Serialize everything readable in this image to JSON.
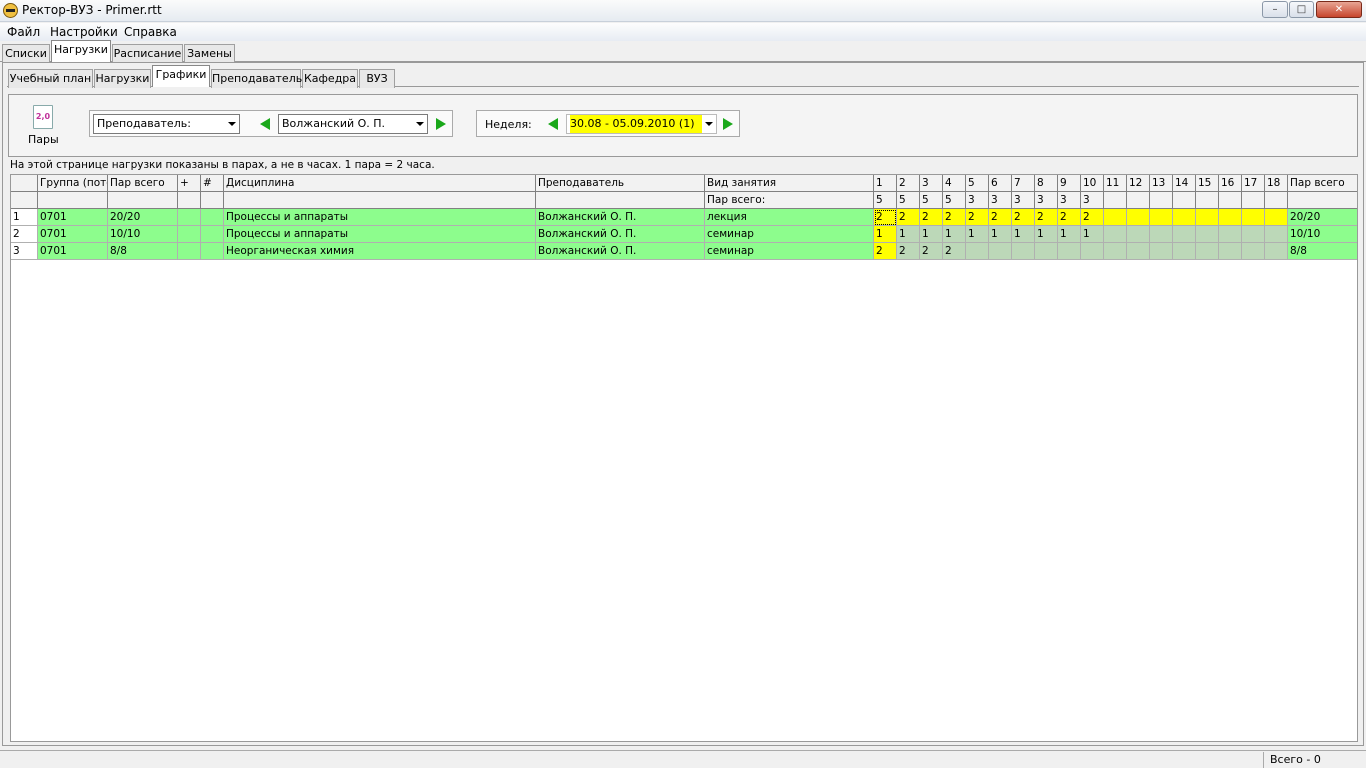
{
  "window": {
    "title": "Ректор-ВУЗ - Primer.rtt",
    "min": "–",
    "max": "□",
    "close": "✕"
  },
  "menu": [
    "Файл",
    "Настройки",
    "Справка"
  ],
  "tabs_top": [
    {
      "label": "Списки",
      "active": false
    },
    {
      "label": "Нагрузки",
      "active": true
    },
    {
      "label": "Расписание",
      "active": false
    },
    {
      "label": "Замены",
      "active": false
    }
  ],
  "tabs_sub": [
    {
      "label": "Учебный план",
      "active": false
    },
    {
      "label": "Нагрузки",
      "active": false
    },
    {
      "label": "Графики",
      "active": true
    },
    {
      "label": "Преподаватель",
      "active": false
    },
    {
      "label": "Кафедра",
      "active": false
    },
    {
      "label": "ВУЗ",
      "active": false
    }
  ],
  "toolbar": {
    "pary_icon_text": "2,0",
    "pary_label": "Пары",
    "filter_combo": "Преподаватель:",
    "teacher_combo": "Волжанский О. П.",
    "week_label": "Неделя:",
    "week_combo": "30.08 - 05.09.2010   (1)"
  },
  "hint": "На этой странице нагрузки показаны в парах, а не в часах. 1 пара = 2 часа.",
  "grid": {
    "headers": [
      "",
      "Группа (поток)",
      "Пар всего",
      "+",
      "#",
      "Дисциплина",
      "Преподаватель",
      "Вид занятия"
    ],
    "week_numbers": [
      "1",
      "2",
      "3",
      "4",
      "5",
      "6",
      "7",
      "8",
      "9",
      "10",
      "11",
      "12",
      "13",
      "14",
      "15",
      "16",
      "17",
      "18"
    ],
    "total_header": "Пар всего",
    "subheader_label": "Пар всего:",
    "subheader_week_values": [
      "5",
      "5",
      "5",
      "5",
      "3",
      "3",
      "3",
      "3",
      "3",
      "3",
      "",
      "",
      "",
      "",
      "",
      "",
      "",
      ""
    ],
    "rows": [
      {
        "num": "1",
        "group": "0701",
        "total": "20/20",
        "plus": "",
        "hash": "",
        "discipline": "Процессы и аппараты",
        "teacher": "Волжанский О. П.",
        "kind": "лекция",
        "weeks": [
          "2",
          "2",
          "2",
          "2",
          "2",
          "2",
          "2",
          "2",
          "2",
          "2",
          "",
          "",
          "",
          "",
          "",
          "",
          "",
          ""
        ],
        "sum": "20/20"
      },
      {
        "num": "2",
        "group": "0701",
        "total": "10/10",
        "plus": "",
        "hash": "",
        "discipline": "Процессы и аппараты",
        "teacher": "Волжанский О. П.",
        "kind": "семинар",
        "weeks": [
          "1",
          "1",
          "1",
          "1",
          "1",
          "1",
          "1",
          "1",
          "1",
          "1",
          "",
          "",
          "",
          "",
          "",
          "",
          "",
          ""
        ],
        "sum": "10/10"
      },
      {
        "num": "3",
        "group": "0701",
        "total": "8/8",
        "plus": "",
        "hash": "",
        "discipline": "Неорганическая химия",
        "teacher": "Волжанский О. П.",
        "kind": "семинар",
        "weeks": [
          "2",
          "2",
          "2",
          "2",
          "",
          "",
          "",
          "",
          "",
          "",
          "",
          "",
          "",
          "",
          "",
          "",
          "",
          ""
        ],
        "sum": "8/8"
      }
    ]
  },
  "status": "Всего - 0",
  "colors": {
    "row_green": "#8dfd8d",
    "highlight_yellow": "#ffff00",
    "week_gray": "#bcd8b8",
    "arrow_green": "#1aa81a"
  }
}
